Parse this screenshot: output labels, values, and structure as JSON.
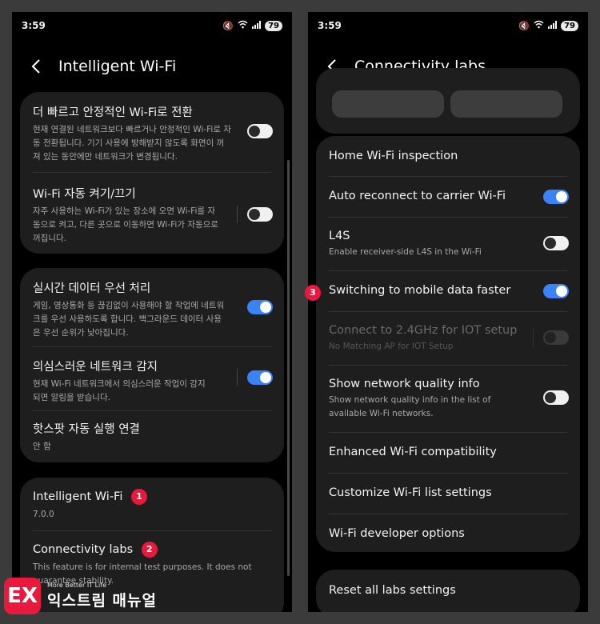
{
  "left": {
    "status": {
      "time": "3:59",
      "battery": "79"
    },
    "title": "Intelligent Wi-Fi",
    "section1": [
      {
        "title": "더 빠르고 안정적인 Wi-Fi로 전환",
        "sub": "현재 연결된 네트워크보다 빠르거나 안정적인 Wi-Fi로 자동 전환됩니다. 기기 사용에 방해받지 않도록 화면이 꺼져 있는 동안에만 네트워크가 변경됩니다.",
        "toggle": "off"
      },
      {
        "title": "Wi-Fi 자동 켜기/끄기",
        "sub": "자주 사용하는 Wi-Fi가 있는 장소에 오면 Wi-Fi를 자동으로 켜고, 다른 곳으로 이동하면 Wi-Fi가 자동으로 꺼집니다.",
        "toggle": "off"
      }
    ],
    "section2": [
      {
        "title": "실시간 데이터 우선 처리",
        "sub": "게임, 영상통화 등 끊김없이 사용해야 할 작업에 네트워크를 우선 사용하도록 합니다. 백그라운드 데이터 사용은 우선 순위가 낮아집니다.",
        "toggle": "on"
      },
      {
        "title": "의심스러운 네트워크 감지",
        "sub": "현재 Wi-Fi 네트워크에서 의심스러운 작업이 감지되면 알림을 받습니다.",
        "toggle": "on"
      },
      {
        "title": "핫스팟 자동 실행 연결",
        "sub": "안 함"
      }
    ],
    "section3": [
      {
        "title": "Intelligent Wi-Fi",
        "sub": "7.0.0",
        "badge": "1"
      },
      {
        "title": "Connectivity labs",
        "sub": "This feature is for internal test purposes. It does not guarantee stability.",
        "badge": "2"
      }
    ]
  },
  "right": {
    "status": {
      "time": "3:59",
      "battery": "79"
    },
    "title": "Connectivity labs",
    "items": [
      {
        "title": "Home Wi-Fi inspection"
      },
      {
        "title": "Auto reconnect to carrier Wi-Fi",
        "toggle": "on"
      },
      {
        "title": "L4S",
        "sub": "Enable receiver-side L4S in the Wi-Fi",
        "toggle": "off"
      },
      {
        "title": "Switching to mobile data faster",
        "toggle": "on",
        "badge": "3"
      },
      {
        "title": "Connect to 2.4GHz for IOT setup",
        "sub": "No Matching AP for IOT Setup",
        "toggle": "disabled"
      },
      {
        "title": "Show network quality info",
        "sub": "Show network quality info in the list of available Wi-Fi networks.",
        "toggle": "off"
      },
      {
        "title": "Enhanced Wi-Fi compatibility"
      },
      {
        "title": "Customize Wi-Fi list settings"
      },
      {
        "title": "Wi-Fi developer options"
      }
    ],
    "reset": "Reset all labs settings"
  },
  "watermark": {
    "tag": "More Better IT Life",
    "name": "익스트림 매뉴얼",
    "mark": "EX"
  },
  "colors": {
    "accent": "#3b82f6",
    "badge": "#e8193c",
    "card": "#1e1e1e"
  }
}
